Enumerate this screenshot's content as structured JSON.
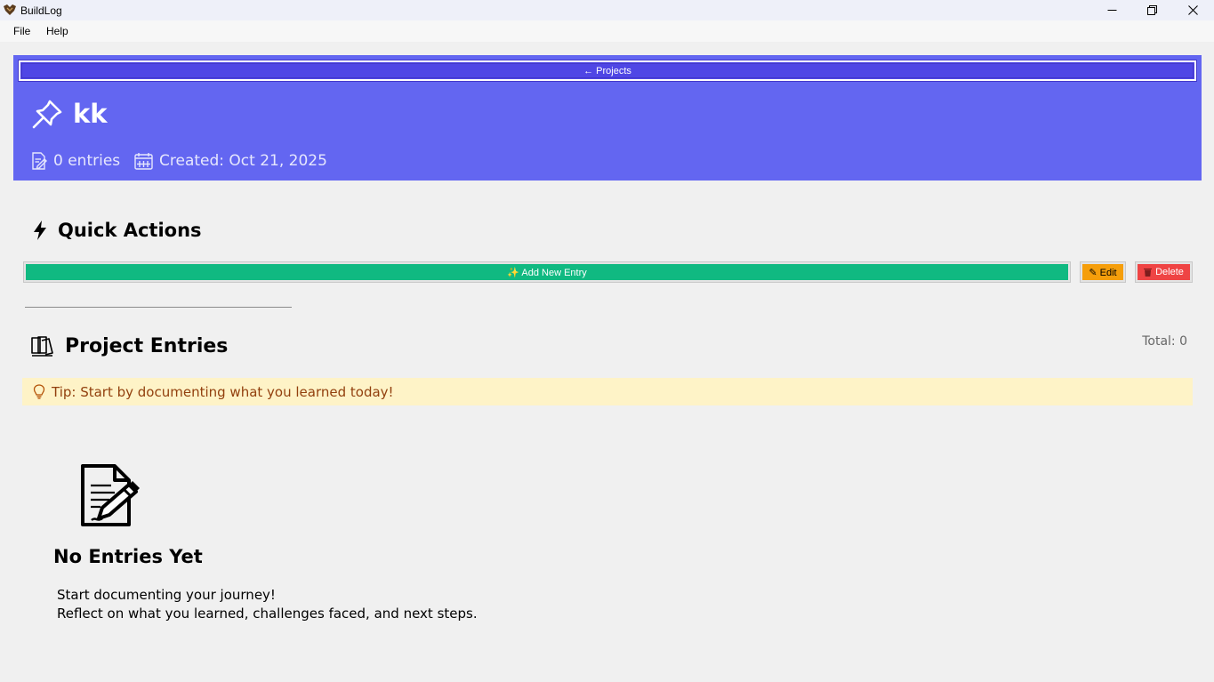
{
  "window": {
    "title": "BuildLog"
  },
  "menu": {
    "items": [
      "File",
      "Help"
    ]
  },
  "header": {
    "back_label": "← Projects",
    "project_name": "kk",
    "entries_text": "0 entries",
    "created_text": "Created: Oct 21, 2025"
  },
  "quick_actions": {
    "title": "Quick Actions",
    "add_label": "✨ Add New Entry",
    "edit_label": "✎ Edit",
    "delete_label": "Delete"
  },
  "entries": {
    "title": "Project Entries",
    "total_text": "Total: 0",
    "tip_text": "Tip: Start by documenting what you learned today!"
  },
  "empty_state": {
    "title": "No Entries Yet",
    "line1": "Start documenting your journey!",
    "line2": "Reflect on what you learned, challenges faced, and next steps."
  },
  "colors": {
    "header_bg": "#6366f1",
    "add_bg": "#10b981",
    "edit_bg": "#f59e0b",
    "delete_bg": "#ef4444",
    "tip_bg": "#fef3c7",
    "tip_text": "#92400e"
  },
  "icons": {
    "app": "buildlog-logo-icon",
    "pin": "pushpin-icon",
    "entries": "memo-icon",
    "created": "calendar-icon",
    "quick_actions": "lightning-bolt-icon",
    "entries_section": "books-icon",
    "tip": "light-bulb-icon",
    "empty": "document-pencil-icon"
  }
}
